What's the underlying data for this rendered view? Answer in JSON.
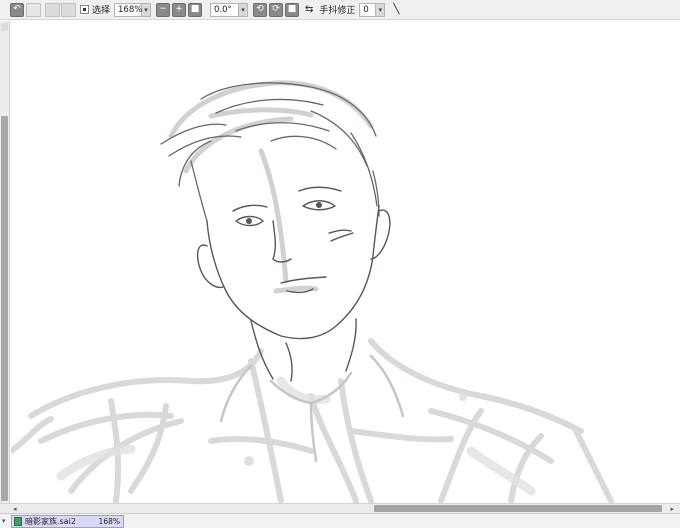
{
  "toolbar": {
    "select_label": "选择",
    "zoom_value": "168%",
    "rotation_value": "0.0°",
    "stabilizer_label": "手抖修正",
    "stabilizer_value": "0"
  },
  "document_tab": {
    "filename": "暗影家族.sai2",
    "zoom": "168%"
  },
  "colors": {
    "toolbar_bg": "#f0f0f0",
    "scroll_thumb": "#a3a3a3",
    "tab_bg": "#d9d9f7",
    "sketch_dark": "#5e5458",
    "sketch_light": "#d6d2d4"
  },
  "icons": {
    "undo": "arrow-undo-icon",
    "zoom_minus": "minus-icon",
    "zoom_plus": "plus-icon",
    "zoom_reset": "square-icon",
    "rotate_ccw": "rotate-left-icon",
    "rotate_cw": "rotate-right-icon",
    "rotate_reset": "square-icon",
    "flip": "flip-icon",
    "pen": "pen-icon"
  }
}
